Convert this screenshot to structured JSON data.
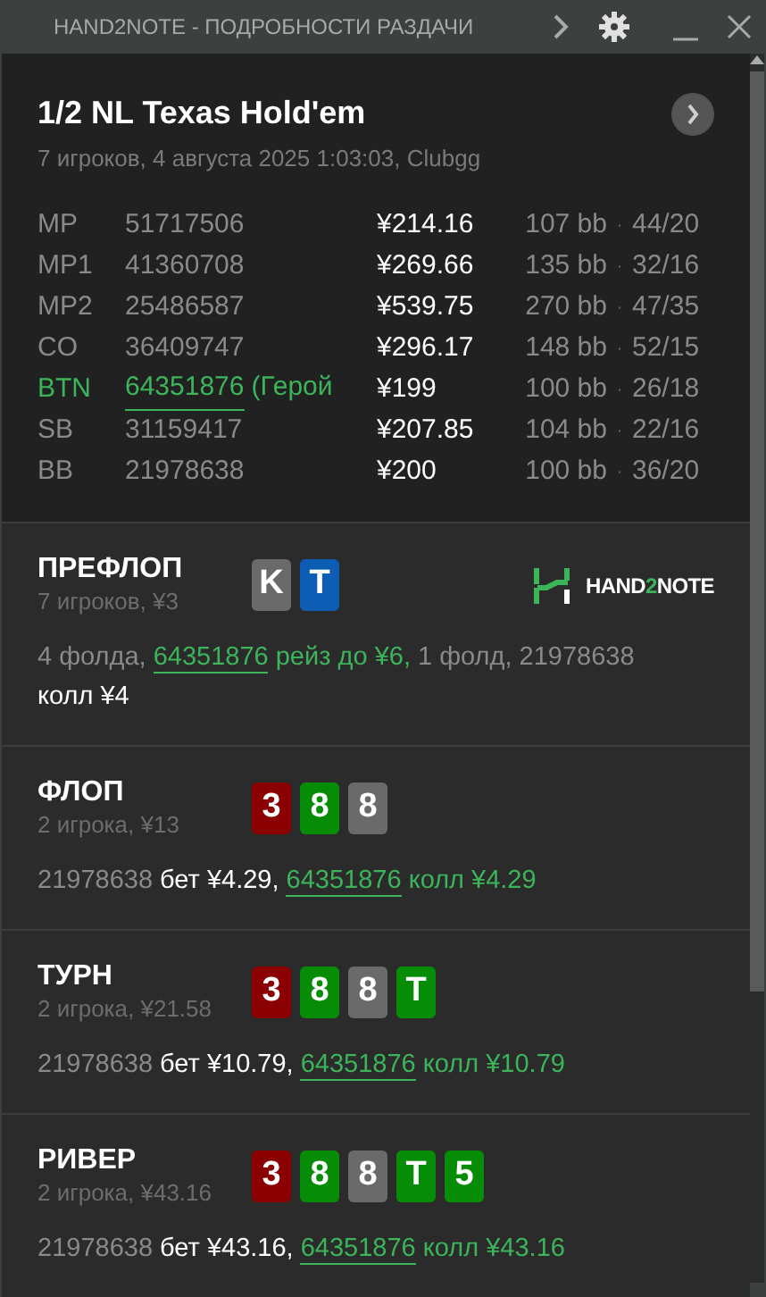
{
  "window": {
    "title": "HAND2NOTE - ПОДРОБНОСТИ РАЗДАЧИ"
  },
  "hand": {
    "title": "1/2 NL Texas Hold'em",
    "subtitle": "7 игроков, 4 августа 2025 1:03:03, Clubgg"
  },
  "players": [
    {
      "position": "MP",
      "id": "51717506",
      "stack": "¥214.16",
      "bb": "107 bb",
      "dot": "·",
      "stats": "44/20",
      "hero": false
    },
    {
      "position": "MP1",
      "id": "41360708",
      "stack": "¥269.66",
      "bb": "135 bb",
      "dot": "·",
      "stats": "32/16",
      "hero": false
    },
    {
      "position": "MP2",
      "id": "25486587",
      "stack": "¥539.75",
      "bb": "270 bb",
      "dot": "·",
      "stats": "47/35",
      "hero": false
    },
    {
      "position": "CO",
      "id": "36409747",
      "stack": "¥296.17",
      "bb": "148 bb",
      "dot": "·",
      "stats": "52/15",
      "hero": false
    },
    {
      "position": "BTN",
      "id": "64351876",
      "tag": "(Герой",
      "stack": "¥199",
      "bb": "100 bb",
      "dot": "·",
      "stats": "26/18",
      "hero": true
    },
    {
      "position": "SB",
      "id": "31159417",
      "stack": "¥207.85",
      "bb": "104 bb",
      "dot": "·",
      "stats": "22/16",
      "hero": false
    },
    {
      "position": "BB",
      "id": "21978638",
      "stack": "¥200",
      "bb": "100 bb",
      "dot": "·",
      "stats": "36/20",
      "hero": false
    }
  ],
  "streets": [
    {
      "name": "ПРЕФЛОП",
      "info": "7 игроков, ¥3",
      "cards": [
        {
          "rank": "K",
          "color": "#6a6a6a"
        },
        {
          "rank": "T",
          "color": "#0d5db5"
        }
      ],
      "logo": {
        "text_start": "HAND",
        "text_mid": "2",
        "text_end": "NOTE"
      },
      "action": [
        {
          "text": "4 фолда, ",
          "kind": "muted"
        },
        {
          "text": "64351876",
          "kind": "hero",
          "link": true
        },
        {
          "text": " рейз до ¥6,",
          "kind": "hero",
          "link": false
        },
        {
          "text": " 1 фолд, 21978638 ",
          "kind": "muted"
        },
        {
          "text": "колл ¥4",
          "kind": "white"
        }
      ]
    },
    {
      "name": "ФЛОП",
      "info": "2 игрока, ¥13",
      "cards": [
        {
          "rank": "3",
          "color": "#8b0000"
        },
        {
          "rank": "8",
          "color": "#068c06"
        },
        {
          "rank": "8",
          "color": "#6a6a6a"
        }
      ],
      "action": [
        {
          "text": "21978638",
          "kind": "muted"
        },
        {
          "text": " бет ¥4.29, ",
          "kind": "white"
        },
        {
          "text": "64351876",
          "kind": "hero",
          "link": true
        },
        {
          "text": " колл ¥4.29",
          "kind": "hero",
          "link": false
        }
      ]
    },
    {
      "name": "ТУРН",
      "info": "2 игрока, ¥21.58",
      "cards": [
        {
          "rank": "3",
          "color": "#8b0000"
        },
        {
          "rank": "8",
          "color": "#068c06"
        },
        {
          "rank": "8",
          "color": "#6a6a6a"
        },
        {
          "rank": "T",
          "color": "#068c06"
        }
      ],
      "action": [
        {
          "text": "21978638",
          "kind": "muted"
        },
        {
          "text": " бет ¥10.79, ",
          "kind": "white"
        },
        {
          "text": "64351876",
          "kind": "hero",
          "link": true
        },
        {
          "text": " колл ¥10.79",
          "kind": "hero",
          "link": false
        }
      ]
    },
    {
      "name": "РИВЕР",
      "info": "2 игрока, ¥43.16",
      "cards": [
        {
          "rank": "3",
          "color": "#8b0000"
        },
        {
          "rank": "8",
          "color": "#068c06"
        },
        {
          "rank": "8",
          "color": "#6a6a6a"
        },
        {
          "rank": "T",
          "color": "#068c06"
        },
        {
          "rank": "5",
          "color": "#068c06"
        }
      ],
      "action": [
        {
          "text": "21978638",
          "kind": "muted"
        },
        {
          "text": " бет ¥43.16, ",
          "kind": "white"
        },
        {
          "text": "64351876",
          "kind": "hero",
          "link": true
        },
        {
          "text": " колл ¥43.16",
          "kind": "hero",
          "link": false
        }
      ]
    }
  ]
}
